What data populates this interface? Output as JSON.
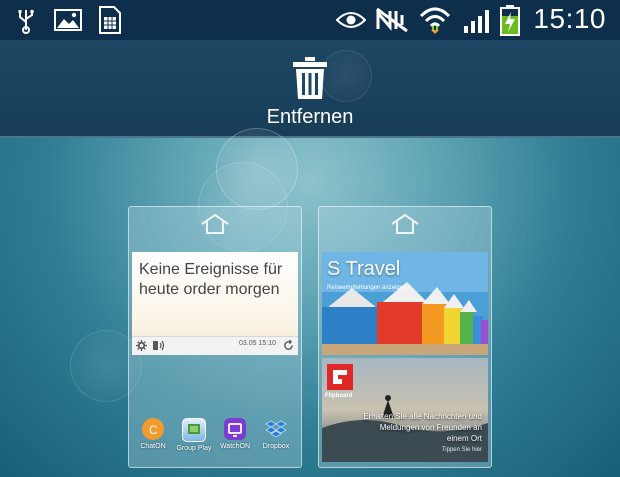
{
  "status_bar": {
    "time": "15:10",
    "icons": [
      "usb-icon",
      "image-icon",
      "sim-card-icon",
      "eye-icon",
      "nfc-muted-icon",
      "wifi-icon",
      "signal-icon",
      "battery-charging-icon"
    ]
  },
  "remove_bar": {
    "label": "Entfernen",
    "icon": "trash-icon"
  },
  "pages": [
    {
      "calendar_widget": {
        "message": "Keine Ereignisse für heute order morgen",
        "time": "03.05 15:10"
      },
      "apps": [
        {
          "label": "ChatON",
          "icon": "chaton-icon",
          "color": "#f29a2e"
        },
        {
          "label": "Group Play",
          "icon": "group-play-icon",
          "color": "#3a8fd8"
        },
        {
          "label": "WatchON",
          "icon": "watchon-icon",
          "color": "#7c3bd1"
        },
        {
          "label": "Dropbox",
          "icon": "dropbox-icon",
          "color": "#2a7fd8"
        }
      ]
    },
    {
      "travel_widget": {
        "title": "S Travel",
        "subtitle": "Reiseempfehlungen anzeigen"
      },
      "flipboard_widget": {
        "logo": "Flipboard",
        "message": "Erhalten Sie alle Nachrichten und Meldungen von Freunden an einem Ort",
        "link": "Tippen Sie hier"
      }
    }
  ],
  "colors": {
    "status_bar_bg": "#0d2f4b",
    "remove_bar_bg": "#1e4764",
    "flipboard_red": "#e12828"
  }
}
